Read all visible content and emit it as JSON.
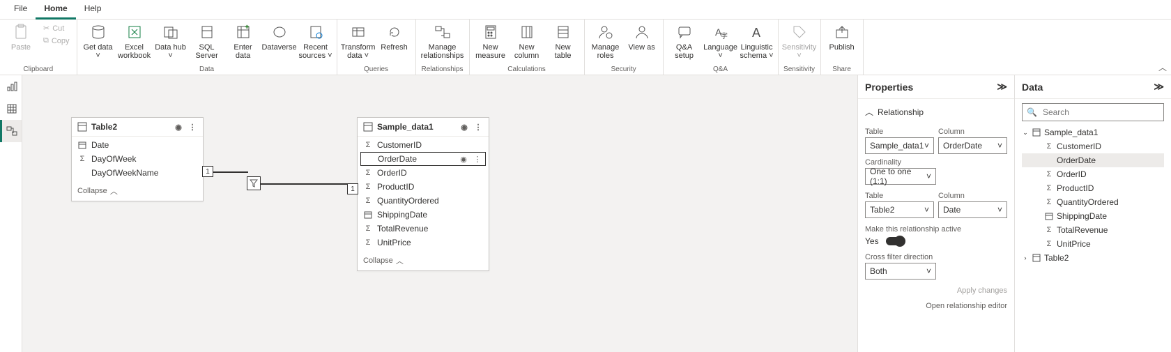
{
  "menu": {
    "file": "File",
    "home": "Home",
    "help": "Help"
  },
  "clipboard": {
    "paste": "Paste",
    "cut": "Cut",
    "copy": "Copy",
    "label": "Clipboard"
  },
  "data_grp": {
    "get_data": "Get data",
    "excel": "Excel workbook",
    "hub": "Data hub",
    "sql": "SQL Server",
    "enter": "Enter data",
    "dataverse": "Dataverse",
    "recent": "Recent sources",
    "label": "Data"
  },
  "queries_grp": {
    "transform": "Transform data",
    "refresh": "Refresh",
    "label": "Queries"
  },
  "rel_grp": {
    "manage": "Manage relationships",
    "label": "Relationships"
  },
  "calc_grp": {
    "measure": "New measure",
    "column": "New column",
    "table": "New table",
    "label": "Calculations"
  },
  "sec_grp": {
    "roles": "Manage roles",
    "viewas": "View as",
    "label": "Security"
  },
  "qa_grp": {
    "setup": "Q&A setup",
    "lang": "Language",
    "ling": "Linguistic schema",
    "label": "Q&A"
  },
  "sens_grp": {
    "sens": "Sensitivity",
    "label": "Sensitivity"
  },
  "share_grp": {
    "publish": "Publish",
    "label": "Share"
  },
  "table2": {
    "name": "Table2",
    "fields": [
      "Date",
      "DayOfWeek",
      "DayOfWeekName"
    ],
    "icons": [
      "cal",
      "sigma",
      ""
    ],
    "collapse": "Collapse"
  },
  "sample": {
    "name": "Sample_data1",
    "fields": [
      "CustomerID",
      "OrderDate",
      "OrderID",
      "ProductID",
      "QuantityOrdered",
      "ShippingDate",
      "TotalRevenue",
      "UnitPrice"
    ],
    "icons": [
      "sigma",
      "",
      "sigma",
      "sigma",
      "sigma",
      "cal",
      "sigma",
      "sigma"
    ],
    "selected_index": 1,
    "collapse": "Collapse"
  },
  "rel": {
    "left_card": "1",
    "right_card": "1"
  },
  "properties": {
    "title": "Properties",
    "section": "Relationship",
    "table_label": "Table",
    "column_label": "Column",
    "table1": "Sample_data1",
    "col1": "OrderDate",
    "card_label": "Cardinality",
    "card_val": "One to one (1:1)",
    "table2": "Table2",
    "col2": "Date",
    "active_label": "Make this relationship active",
    "active_val": "Yes",
    "cross_label": "Cross filter direction",
    "cross_val": "Both",
    "apply": "Apply changes",
    "open": "Open relationship editor"
  },
  "datapane": {
    "title": "Data",
    "search_placeholder": "Search",
    "t1": "Sample_data1",
    "t1_fields": [
      "CustomerID",
      "OrderDate",
      "OrderID",
      "ProductID",
      "QuantityOrdered",
      "ShippingDate",
      "TotalRevenue",
      "UnitPrice"
    ],
    "t1_icons": [
      "sigma",
      "",
      "sigma",
      "sigma",
      "sigma",
      "cal",
      "sigma",
      "sigma"
    ],
    "t1_selected_index": 1,
    "t2": "Table2"
  }
}
